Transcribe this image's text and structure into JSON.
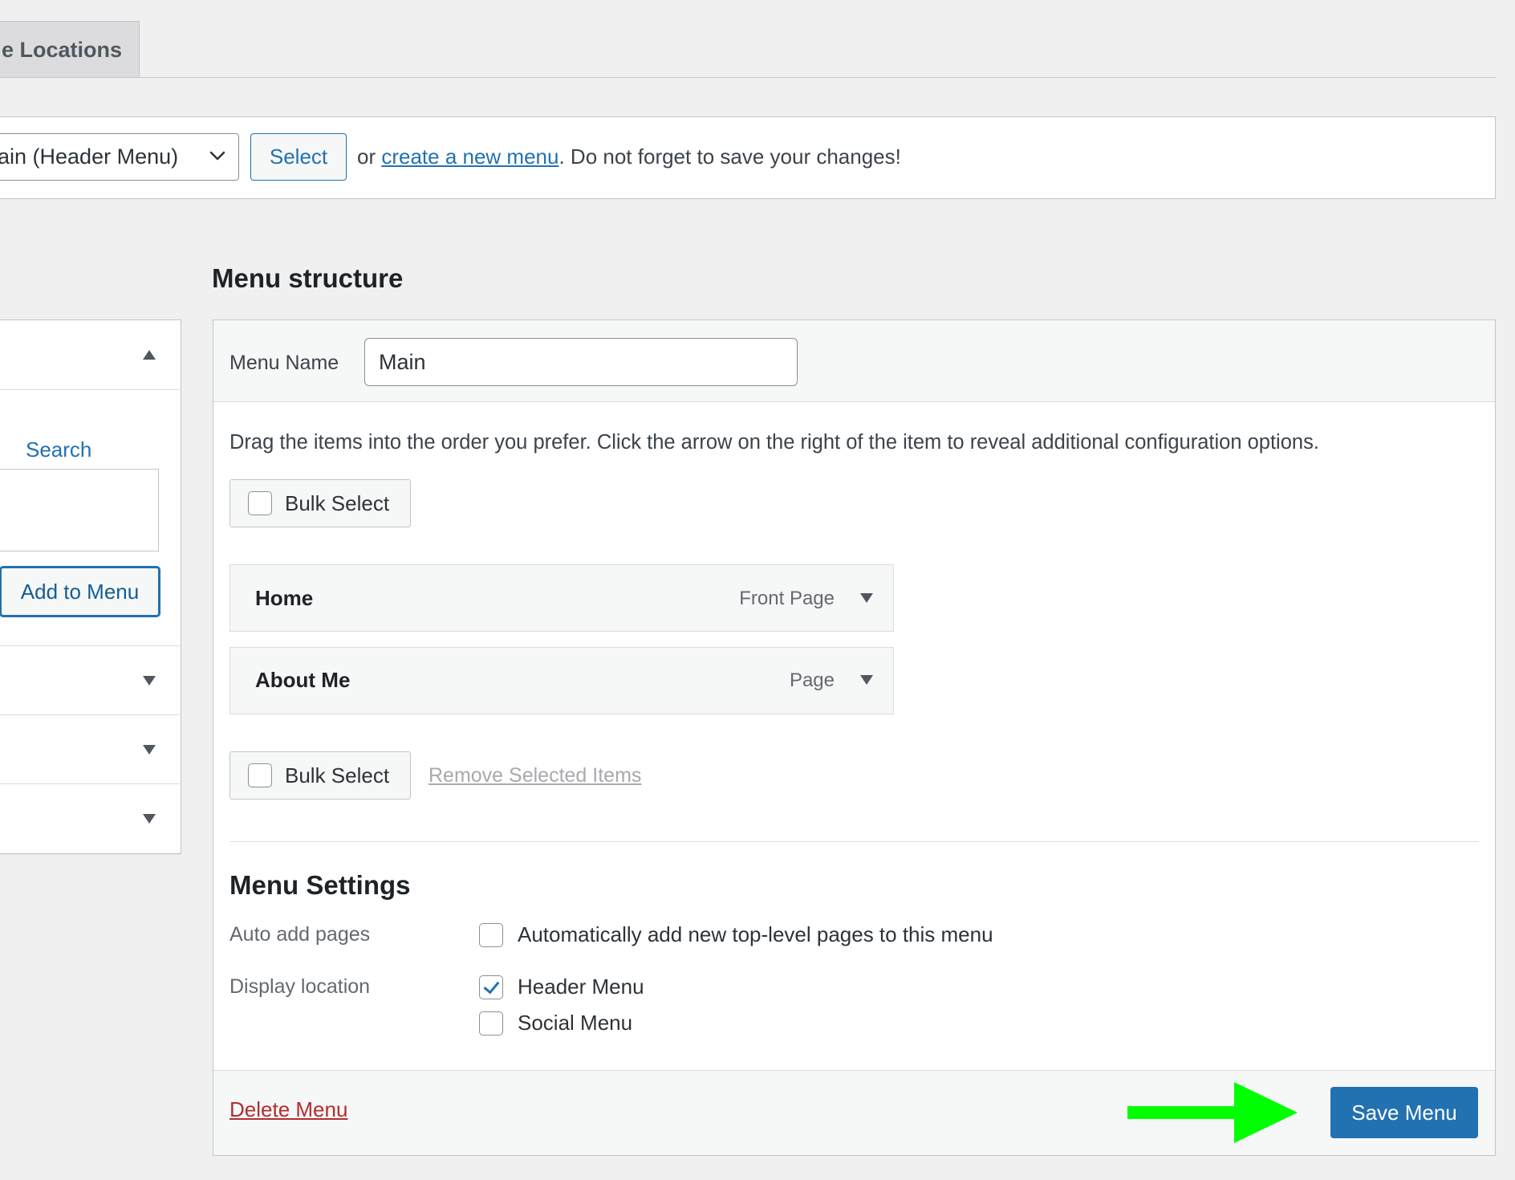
{
  "tabs": {
    "manage_locations": "e Locations"
  },
  "manage": {
    "selected_menu": "ain (Header Menu)",
    "select_button": "Select",
    "or_text": "or ",
    "create_link": "create a new menu",
    "reminder": ". Do not forget to save your changes!"
  },
  "left_panel": {
    "search_link": "Search",
    "search_value": "",
    "add_button": "Add to Menu"
  },
  "menu_structure": {
    "title": "Menu structure",
    "name_label": "Menu Name",
    "name_value": "Main",
    "instructions": "Drag the items into the order you prefer. Click the arrow on the right of the item to reveal additional configuration options.",
    "bulk_select": "Bulk Select",
    "remove_selected": "Remove Selected Items",
    "items": [
      {
        "title": "Home",
        "type": "Front Page"
      },
      {
        "title": "About Me",
        "type": "Page"
      }
    ]
  },
  "settings": {
    "title": "Menu Settings",
    "auto_add_label": "Auto add pages",
    "auto_add_option": "Automatically add new top-level pages to this menu",
    "auto_add_checked": false,
    "display_label": "Display location",
    "locations": [
      {
        "label": "Header Menu",
        "checked": true
      },
      {
        "label": "Social Menu",
        "checked": false
      }
    ]
  },
  "footer": {
    "delete_link": "Delete Menu",
    "save_button": "Save Menu"
  },
  "colors": {
    "wp_blue": "#2271b1",
    "delete_red": "#b32d2e",
    "annotation_arrow": "#00ff00"
  },
  "icons": [
    "chevron-down-icon",
    "triangle-up-icon",
    "triangle-down-icon",
    "checkbox-icon",
    "checkmark-icon",
    "arrow-annotation-icon"
  ]
}
